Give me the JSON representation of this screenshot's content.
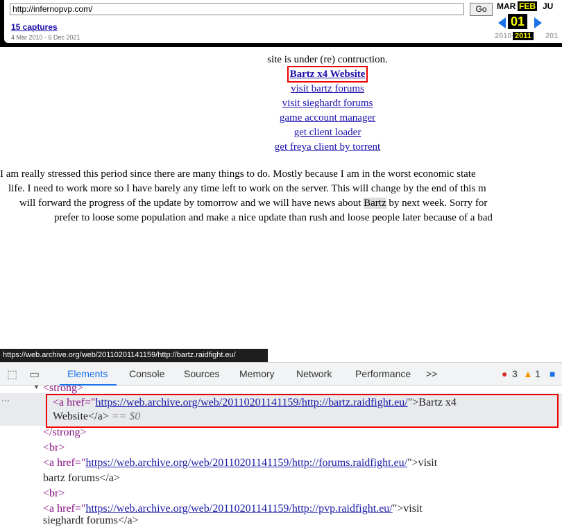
{
  "wayback": {
    "url": "http://infernopvp.com/",
    "go": "Go",
    "captures": "15 captures",
    "range": "4 Mar 2010 - 6 Dec 2021",
    "months": [
      "MAR",
      "FEB",
      "JU"
    ],
    "day": "01",
    "years": [
      "2010",
      "2011",
      "201"
    ]
  },
  "content": {
    "notice": "site is under (re) contruction.",
    "links": [
      "Bartz x4 Website",
      "visit bartz forums",
      "visit sieghardt forums",
      "game account manager",
      "get client loader",
      "get freya client by torrent"
    ],
    "para_lines": [
      "I am really stressed this period since there are many things to do. Mostly because I am in the worst economic state",
      "life. I need to work more so I have barely any time left to work on the server. This will change by the end of this m",
      "will forward the progress of the update by tomorrow and we will have news about ",
      " by next week. Sorry for",
      "prefer to loose some population and make a nice update than rush and loose people later because of a bad"
    ],
    "highlight": "Bartz"
  },
  "status_url": "https://web.archive.org/web/20110201141159/http://bartz.raidfight.eu/",
  "devtools": {
    "tabs": [
      "Elements",
      "Console",
      "Sources",
      "Memory",
      "Network",
      "Performance"
    ],
    "more": ">>",
    "errors": "3",
    "warnings": "1",
    "code": {
      "strong_open": "<strong>",
      "a1_open": "<a href=\"",
      "a1_href": "https://web.archive.org/web/20110201141159/http://bartz.raidfight.eu/",
      "a1_close": "\">Bartz x4",
      "a1_text2": "Website</a>",
      "eq": " == $0",
      "strong_close": "</strong>",
      "br": "<br>",
      "a2_href": "https://web.archive.org/web/20110201141159/http://forums.raidfight.eu/",
      "a2_close": "\">visit",
      "a2_text2": "bartz forums</a>",
      "a3_href": "https://web.archive.org/web/20110201141159/http://pvp.raidfight.eu/",
      "a3_close": "\">visit",
      "a3_text2": "sieghardt forums</a>"
    }
  }
}
